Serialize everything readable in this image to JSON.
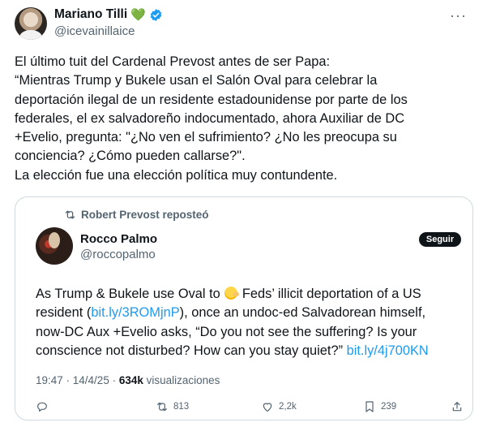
{
  "author": {
    "name": "Mariano Tilli",
    "heart": "💚",
    "handle": "@icevainillaice",
    "more": "···"
  },
  "tweet": {
    "lines": [
      "El último tuit del Cardenal Prevost antes de ser Papa:",
      "“Mientras Trump y Bukele usan el Salón Oval para celebrar la",
      "deportación ilegal de un residente estadounidense por parte de los",
      "federales, el ex salvadoreño indocumentado, ahora Auxiliar de DC",
      "+Evelio, pregunta: \"¿No ven el sufrimiento? ¿No les preocupa su",
      "conciencia? ¿Cómo pueden callarse?\".",
      "La elección fue una elección política muy contundente."
    ]
  },
  "quote": {
    "repost_label": "Robert Prevost reposteó",
    "name": "Rocco Palmo",
    "handle": "@roccopalmo",
    "follow_label": "Seguir",
    "line1_a": "As Trump & Bukele use Oval to",
    "line1_b": "Feds’ illicit deportation of a US",
    "line2_a": "resident (",
    "line2_link": "bit.ly/3ROMjnP",
    "line2_b": "), once an undoc-ed Salvadorean himself,",
    "line3": "now-DC Aux +Evelio asks, “Do you not see the suffering? Is your",
    "line4_a": "conscience not disturbed? How can you stay quiet?”",
    "line4_link": "bit.ly/4j700KN",
    "time": "19:47 · 14/4/25 · ",
    "views_count": "634k",
    "views_label": " visualizaciones"
  },
  "actions": {
    "reposts": "813",
    "likes": "2,2k",
    "bookmarks": "239"
  },
  "colors": {
    "link": "#1d9bf0",
    "secondary": "#536471",
    "verified": "#1d9bf0",
    "heart": "#6cbd45"
  }
}
